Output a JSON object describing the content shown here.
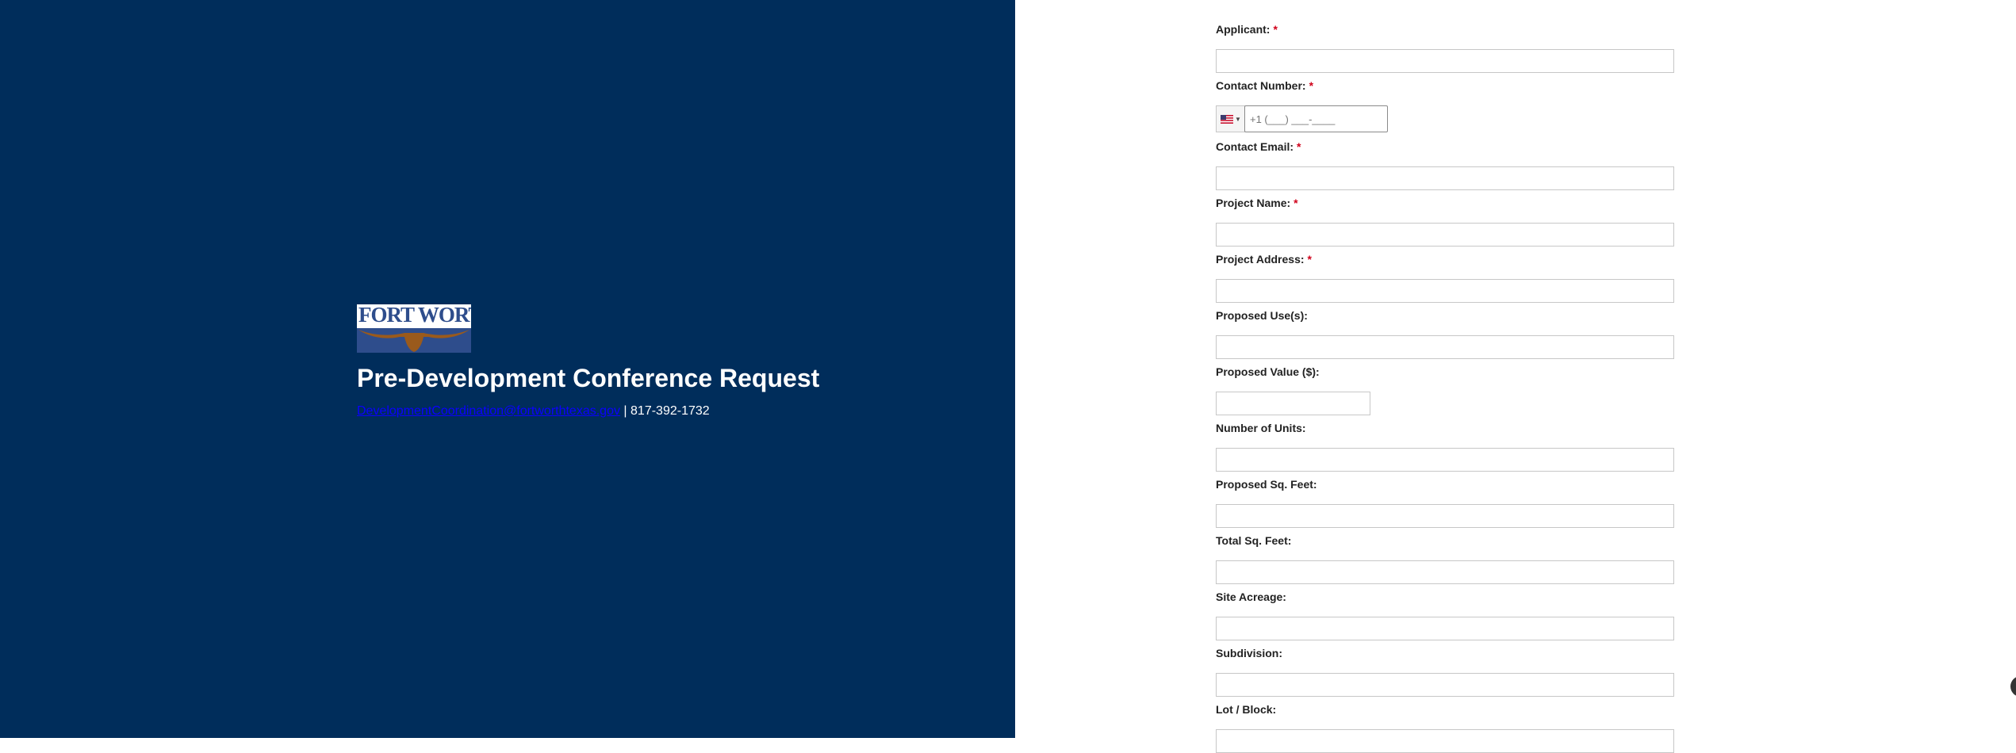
{
  "page": {
    "title": "Pre-Development Conference Request",
    "logo_text": "FORT WORTH",
    "logo_mark": "®",
    "email": "DevelopmentCoordination@fortworthtexas.gov",
    "separator": "|",
    "phone": "817-392-1732"
  },
  "form": {
    "required_mark": "*",
    "fields": {
      "applicant": "Applicant:",
      "contact_number": "Contact Number:",
      "contact_email": "Contact Email:",
      "project_name": "Project Name:",
      "project_address": "Project Address:",
      "proposed_uses": "Proposed Use(s):",
      "proposed_value": "Proposed Value ($):",
      "number_of_units": "Number of Units:",
      "proposed_sq_feet": "Proposed Sq. Feet:",
      "total_sq_feet": "Total Sq. Feet:",
      "site_acreage": "Site Acreage:",
      "subdivision": "Subdivision:",
      "lot_block": "Lot / Block:"
    },
    "phone_placeholder": "+1 (___) ___-____",
    "country_flag": "us-flag-icon"
  },
  "colors": {
    "panel": "#002d5b",
    "required": "#d0021b",
    "link": "#0b00ff"
  }
}
